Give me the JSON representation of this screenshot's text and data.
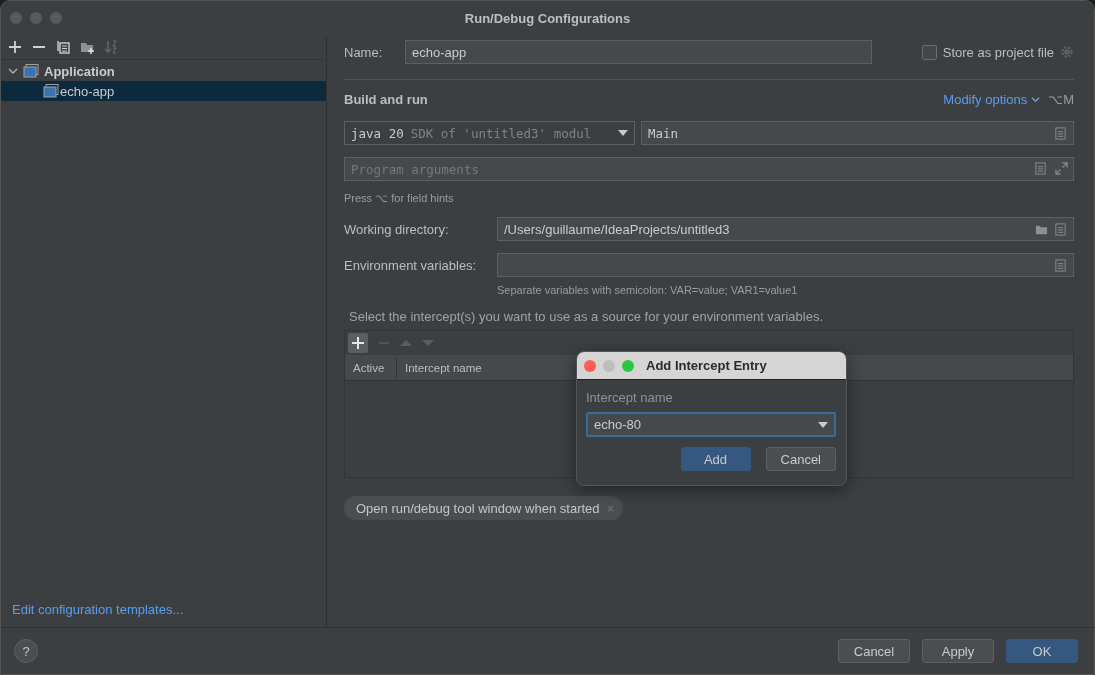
{
  "window": {
    "title": "Run/Debug Configurations"
  },
  "sidebar": {
    "tree": [
      {
        "label": "Application",
        "expanded": true,
        "selected": false,
        "children": [
          {
            "label": "echo-app",
            "selected": true
          }
        ]
      }
    ],
    "templates_link": "Edit configuration templates..."
  },
  "form": {
    "name_label": "Name:",
    "name_value": "echo-app",
    "store_as_project_file": {
      "label": "Store as project file",
      "checked": false
    },
    "section_title": "Build and run",
    "modify_options": "Modify options",
    "modify_shortcut": "⌥M",
    "jdk": {
      "value": "java 20",
      "detail": "SDK of 'untitled3' modul"
    },
    "main_class": "Main",
    "program_arguments": {
      "placeholder": "Program arguments"
    },
    "field_hint": "Press ⌥ for field hints",
    "working_directory": {
      "label": "Working directory:",
      "value": "/Users/guillaume/IdeaProjects/untitled3"
    },
    "environment_variables": {
      "label": "Environment variables:",
      "hint": "Separate variables with semicolon: VAR=value; VAR1=value1"
    },
    "intercept_prompt": "Select the intercept(s) you want to use as a source for your environment variables.",
    "intercept_table": {
      "columns": [
        "Active",
        "Intercept name"
      ]
    },
    "option_chips": [
      "Open run/debug tool window when started"
    ]
  },
  "dialog": {
    "title": "Add Intercept Entry",
    "field_label": "Intercept name",
    "field_value": "echo-80",
    "buttons": [
      {
        "label": "Add",
        "kind": "default"
      },
      {
        "label": "Cancel",
        "kind": "normal"
      }
    ]
  },
  "footer": {
    "help": "?",
    "buttons": [
      {
        "label": "Cancel",
        "kind": "normal"
      },
      {
        "label": "Apply",
        "kind": "normal"
      },
      {
        "label": "OK",
        "kind": "default"
      }
    ]
  }
}
